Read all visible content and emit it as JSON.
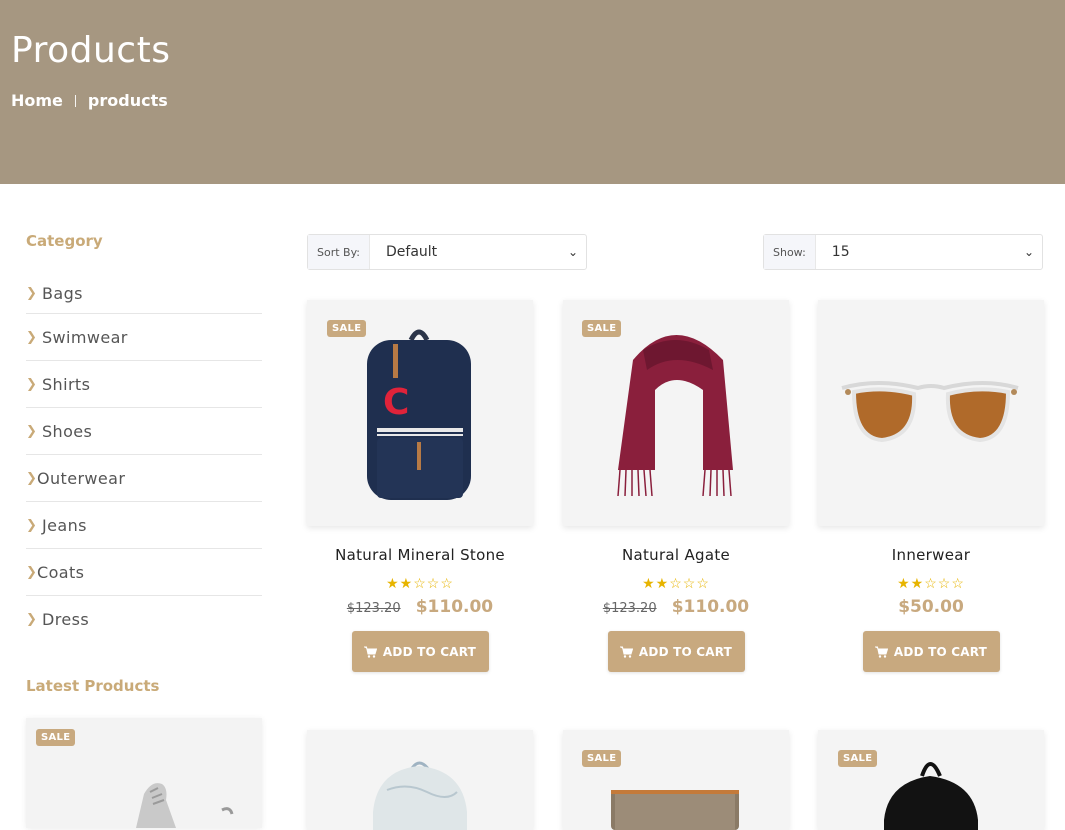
{
  "hero": {
    "title": "Products",
    "breadcrumb": {
      "home": "Home",
      "current": "products"
    }
  },
  "sidebar": {
    "category_heading": "Category",
    "categories": [
      "Bags",
      "Swimwear",
      "Shirts",
      "Shoes",
      "Outerwear",
      "Jeans",
      "Coats",
      "Dress"
    ],
    "latest_heading": "Latest Products",
    "latest_badge": "SALE"
  },
  "toolbar": {
    "sort_label": "Sort By:",
    "sort_value": "Default",
    "show_label": "Show:",
    "show_value": "15"
  },
  "products": [
    {
      "name": "Natural Mineral Stone",
      "badge": "SALE",
      "old_price": "$123.20",
      "price": "$110.00",
      "rating": 2,
      "rating_max": 5,
      "button": "ADD TO CART",
      "image": "navy-backpack"
    },
    {
      "name": "Natural Agate",
      "badge": "SALE",
      "old_price": "$123.20",
      "price": "$110.00",
      "rating": 2,
      "rating_max": 5,
      "button": "ADD TO CART",
      "image": "burgundy-scarf"
    },
    {
      "name": "Innerwear",
      "badge": "",
      "old_price": "",
      "price": "$50.00",
      "rating": 2,
      "rating_max": 5,
      "button": "ADD TO CART",
      "image": "sunglasses"
    }
  ],
  "bottom_products": [
    {
      "badge": "",
      "image": "light-backpack"
    },
    {
      "badge": "SALE",
      "image": "wallet"
    },
    {
      "badge": "SALE",
      "image": "black-backpack"
    }
  ],
  "colors": {
    "hero_bg": "#a69781",
    "accent": "#c8a97f",
    "star": "#e7b400"
  }
}
